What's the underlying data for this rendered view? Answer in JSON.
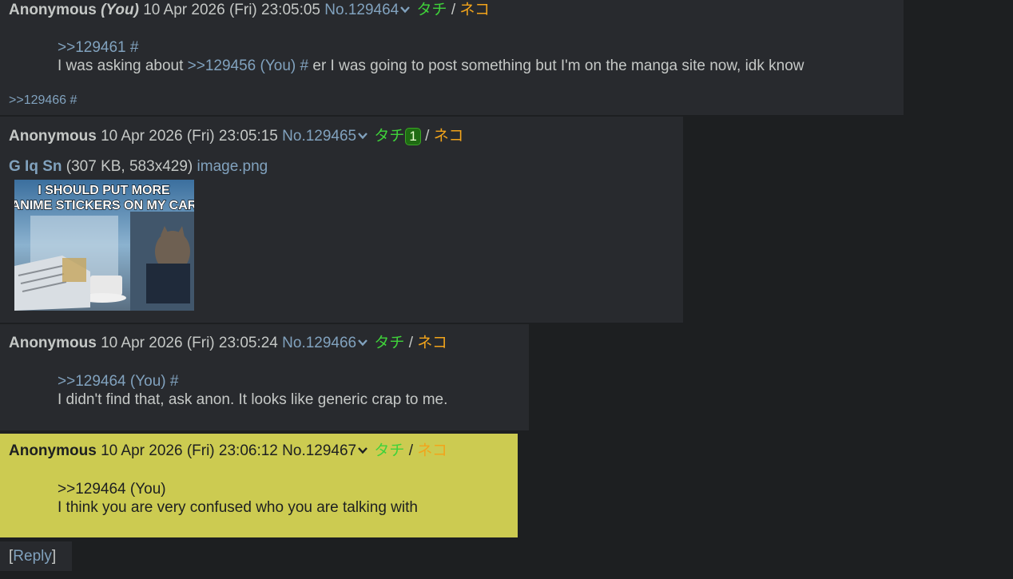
{
  "posts": [
    {
      "name": "Anonymous",
      "you": "(You)",
      "date": "10 Apr 2026 (Fri) 23:05:05",
      "no": "No.129464",
      "tachi": "タチ",
      "sep": "/",
      "neko": "ネコ",
      "quote": ">>129461 #",
      "text_a": "I was asking about",
      "inline_quote": ">>129456 (You) #",
      "text_b": "er I was going to post something but I'm on the manga site now, idk know",
      "backlink": ">>129466 #"
    },
    {
      "name": "Anonymous",
      "date": "10 Apr 2026 (Fri) 23:05:15",
      "no": "No.129465",
      "tachi": "タチ",
      "badge": "1",
      "sep": "/",
      "neko": "ネコ",
      "file_tags": "G Iq Sn",
      "file_info": "(307 KB, 583x429)",
      "file_name": "image.png",
      "image_caption_1": "I SHOULD PUT MORE",
      "image_caption_2": "ANIME STICKERS ON MY CAR"
    },
    {
      "name": "Anonymous",
      "date": "10 Apr 2026 (Fri) 23:05:24",
      "no": "No.129466",
      "tachi": "タチ",
      "sep": "/",
      "neko": "ネコ",
      "quote": ">>129464 (You) #",
      "text": "I didn't find that, ask anon. It looks like generic crap to me."
    },
    {
      "name": "Anonymous",
      "date": "10 Apr 2026 (Fri) 23:06:12",
      "no": "No.129467",
      "tachi": "タチ",
      "sep": "/",
      "neko": "ネコ",
      "quote": ">>129464 (You)",
      "text": "I think you are very confused who you are talking with"
    }
  ],
  "reply": {
    "open": "[",
    "label": "Reply",
    "close": "]"
  },
  "icons": {
    "post_menu": "chevron-down-icon"
  },
  "colors": {
    "highlight": "#cccb51",
    "link": "#81a2be",
    "tachi": "#3fd23a",
    "neko": "#f2a41b"
  }
}
